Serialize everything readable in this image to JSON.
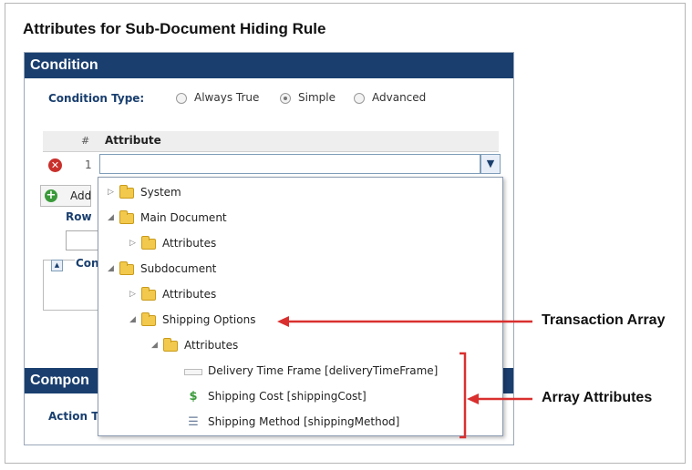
{
  "page_title": "Attributes for Sub-Document Hiding Rule",
  "condition": {
    "header": "Condition",
    "type_label": "Condition Type:",
    "options": [
      "Always True",
      "Simple",
      "Advanced"
    ],
    "selected": "Simple"
  },
  "grid": {
    "col_num": "#",
    "col_attribute": "Attribute",
    "row_number": "1",
    "add_label": "Add"
  },
  "row_label": "Row",
  "con_label": "Con",
  "component": {
    "header": "Compon",
    "action_label": "Action T"
  },
  "tree": {
    "system": "System",
    "main_document": "Main Document",
    "main_attributes": "Attributes",
    "subdocument": "Subdocument",
    "sub_attributes": "Attributes",
    "shipping_options": "Shipping Options",
    "shipping_attributes": "Attributes",
    "delivery_time_frame": "Delivery Time Frame [deliveryTimeFrame]",
    "shipping_cost": "Shipping Cost [shippingCost]",
    "shipping_method": "Shipping Method [shippingMethod]"
  },
  "callouts": {
    "transaction_array": "Transaction Array",
    "array_attributes": "Array Attributes"
  },
  "colors": {
    "header_bg": "#1a3f6f",
    "annotation_red": "#d9302f"
  }
}
